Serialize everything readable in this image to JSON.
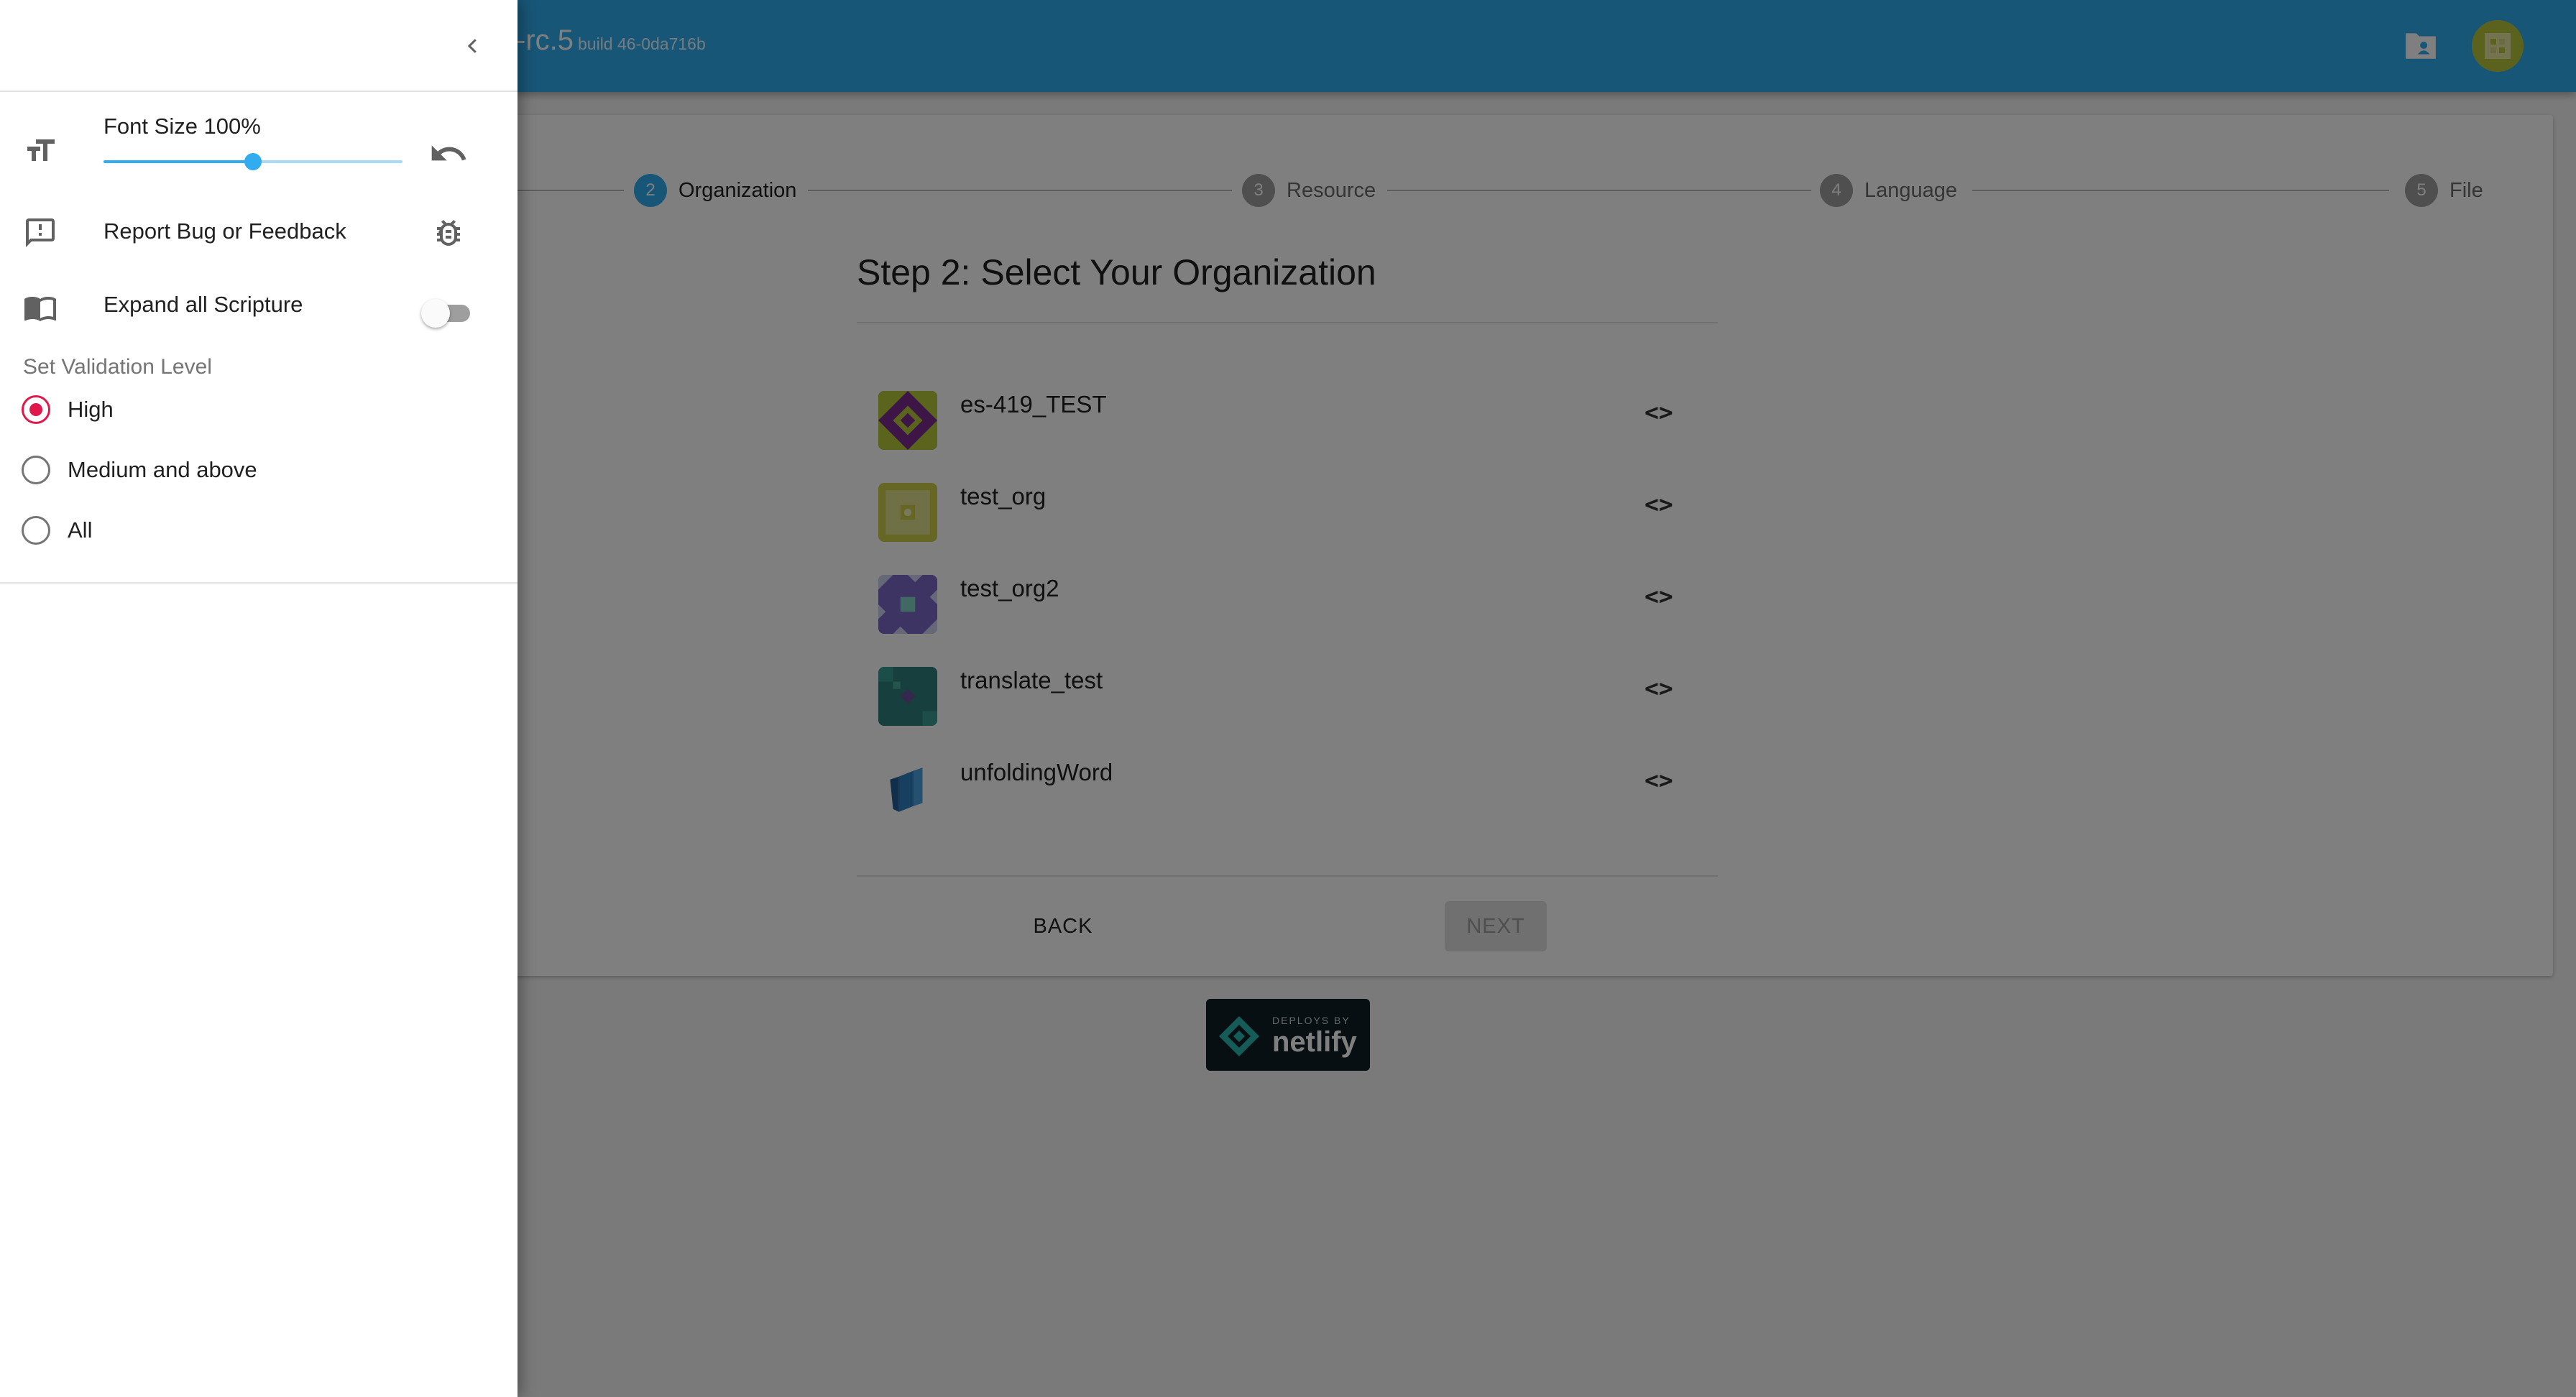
{
  "app": {
    "title": "-rc.5",
    "build": "build 46-0da716b"
  },
  "stepper": {
    "steps": [
      {
        "number": "2",
        "label": "Organization"
      },
      {
        "number": "3",
        "label": "Resource"
      },
      {
        "number": "4",
        "label": "Language"
      },
      {
        "number": "5",
        "label": "File"
      }
    ]
  },
  "main": {
    "heading": "Step 2: Select Your Organization",
    "organizations": [
      {
        "name": "es-419_TEST",
        "code_icon": "<>"
      },
      {
        "name": "test_org",
        "code_icon": "<>"
      },
      {
        "name": "test_org2",
        "code_icon": "<>"
      },
      {
        "name": "translate_test",
        "code_icon": "<>"
      },
      {
        "name": "unfoldingWord",
        "code_icon": "<>"
      }
    ],
    "back_label": "BACK",
    "next_label": "NEXT"
  },
  "netlify": {
    "small": "DEPLOYS BY",
    "big": "netlify"
  },
  "drawer": {
    "font_size_label": "Font Size 100%",
    "font_size_level": 0.5,
    "report_label": "Report Bug or Feedback",
    "expand_label": "Expand all Scripture",
    "expand_on": false,
    "validation_label": "Set Validation Level",
    "validation_options": [
      "High",
      "Medium and above",
      "All"
    ],
    "validation_selected": "High"
  },
  "colors": {
    "primary": "#31adef",
    "accent": "#e0194d"
  }
}
